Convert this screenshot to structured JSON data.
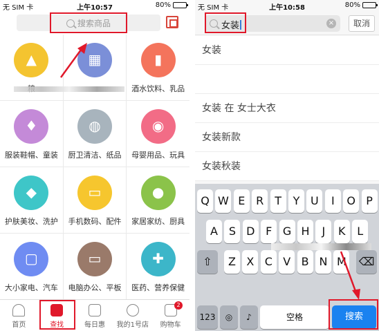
{
  "left": {
    "status": {
      "carrier": "无 SIM 卡",
      "time": "上午10:57",
      "battery": "80%"
    },
    "search_placeholder": "搜索商品",
    "categories": [
      {
        "label": "粮",
        "color": "#f4c430",
        "glyph": "▲"
      },
      {
        "label": "",
        "color": "#7b8fd8",
        "glyph": "▦"
      },
      {
        "label": "酒水饮料、乳品",
        "color": "#f4745c",
        "glyph": "▮"
      },
      {
        "label": "服装鞋帽、童装",
        "color": "#c48ad8",
        "glyph": "♦"
      },
      {
        "label": "厨卫清洁、纸品",
        "color": "#a8b4bd",
        "glyph": "◍"
      },
      {
        "label": "母婴用品、玩具",
        "color": "#f26c86",
        "glyph": "◉"
      },
      {
        "label": "护肤美妆、洗护",
        "color": "#3ec6c8",
        "glyph": "◆"
      },
      {
        "label": "手机数码、配件",
        "color": "#f6c62e",
        "glyph": "▭"
      },
      {
        "label": "家居家纺、厨具",
        "color": "#8bc34a",
        "glyph": "●"
      },
      {
        "label": "大小家电、汽车",
        "color": "#6f8cf2",
        "glyph": "▢"
      },
      {
        "label": "电脑办公、平板",
        "color": "#9a7a6a",
        "glyph": "▭"
      },
      {
        "label": "医药、营养保健",
        "color": "#3cb6c9",
        "glyph": "✚"
      }
    ],
    "tabs": [
      {
        "label": "首页",
        "icon": "home-icon",
        "active": false
      },
      {
        "label": "查找",
        "icon": "find-icon",
        "active": true
      },
      {
        "label": "每日惠",
        "icon": "calendar-icon",
        "active": false
      },
      {
        "label": "我的1号店",
        "icon": "user-icon",
        "active": false
      },
      {
        "label": "购物车",
        "icon": "cart-icon",
        "active": false,
        "badge": "2"
      }
    ]
  },
  "right": {
    "status": {
      "carrier": "无 SIM 卡",
      "time": "上午10:58",
      "battery": "80%"
    },
    "search_value": "女装",
    "cancel_label": "取消",
    "suggestions": [
      "女装",
      "",
      "女装 在 女士大衣",
      "女装新款",
      "女装秋装"
    ],
    "keyboard": {
      "row1": [
        "Q",
        "W",
        "E",
        "R",
        "T",
        "Y",
        "U",
        "I",
        "O",
        "P"
      ],
      "row2": [
        "A",
        "S",
        "D",
        "F",
        "G",
        "H",
        "J",
        "K",
        "L"
      ],
      "row3": [
        "Z",
        "X",
        "C",
        "V",
        "B",
        "N",
        "M"
      ],
      "num_key": "123",
      "space_key": "空格",
      "search_key": "搜索"
    }
  }
}
